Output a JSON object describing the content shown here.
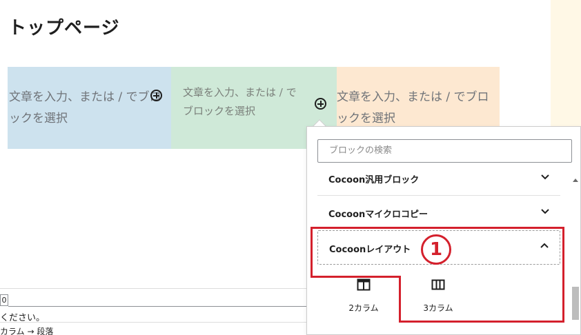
{
  "page": {
    "title": "トップページ"
  },
  "columns": [
    {
      "placeholder": "文章を入力、または / でブロックを選択",
      "bg": "#cde2ee"
    },
    {
      "placeholder": "文章を入力、または / でブロックを選択",
      "bg": "#cfe9d8"
    },
    {
      "placeholder": "文章を入力、または / でブロックを選択",
      "bg": "#fde8d1"
    }
  ],
  "inserter": {
    "search_placeholder": "ブロックの検索",
    "categories": [
      {
        "label": "Cocoon汎用ブロック",
        "state": "collapsed"
      },
      {
        "label": "Cocoonマイクロコピー",
        "state": "collapsed"
      },
      {
        "label": "Cocoonレイアウト",
        "state": "expanded"
      }
    ],
    "blocks": [
      {
        "label": "2カラム",
        "icon": "two-column-icon"
      },
      {
        "label": "3カラム",
        "icon": "three-column-icon"
      }
    ]
  },
  "annotation": {
    "number": "1",
    "color": "#d4202c"
  },
  "bottom_panel": {
    "input_value": "0",
    "help_text": "ください。",
    "breadcrumb": "カラム → 段落"
  }
}
